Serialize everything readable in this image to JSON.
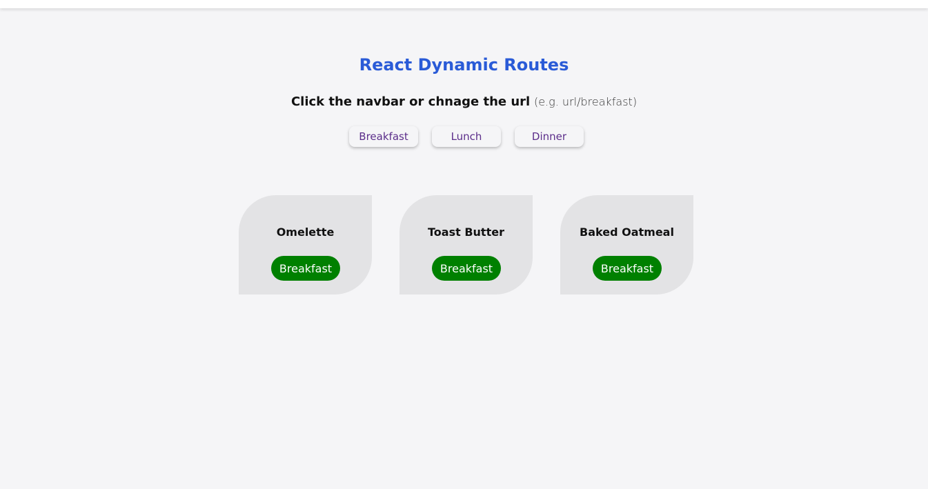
{
  "header": {
    "title": "React Dynamic Routes",
    "instruction_strong": "Click the navbar or chnage the url",
    "instruction_hint": "(e.g.   url/breakfast)"
  },
  "nav": {
    "items": [
      {
        "label": "Breakfast"
      },
      {
        "label": "Lunch"
      },
      {
        "label": "Dinner"
      }
    ]
  },
  "cards": [
    {
      "title": "Omelette",
      "category": "Breakfast"
    },
    {
      "title": "Toast Butter",
      "category": "Breakfast"
    },
    {
      "title": "Baked Oatmeal",
      "category": "Breakfast"
    }
  ],
  "colors": {
    "title": "#2a5bd7",
    "nav_text": "#5b2d8a",
    "badge": "#008000",
    "card_bg": "#e3e3e5",
    "page_bg": "#f5f5f7"
  }
}
